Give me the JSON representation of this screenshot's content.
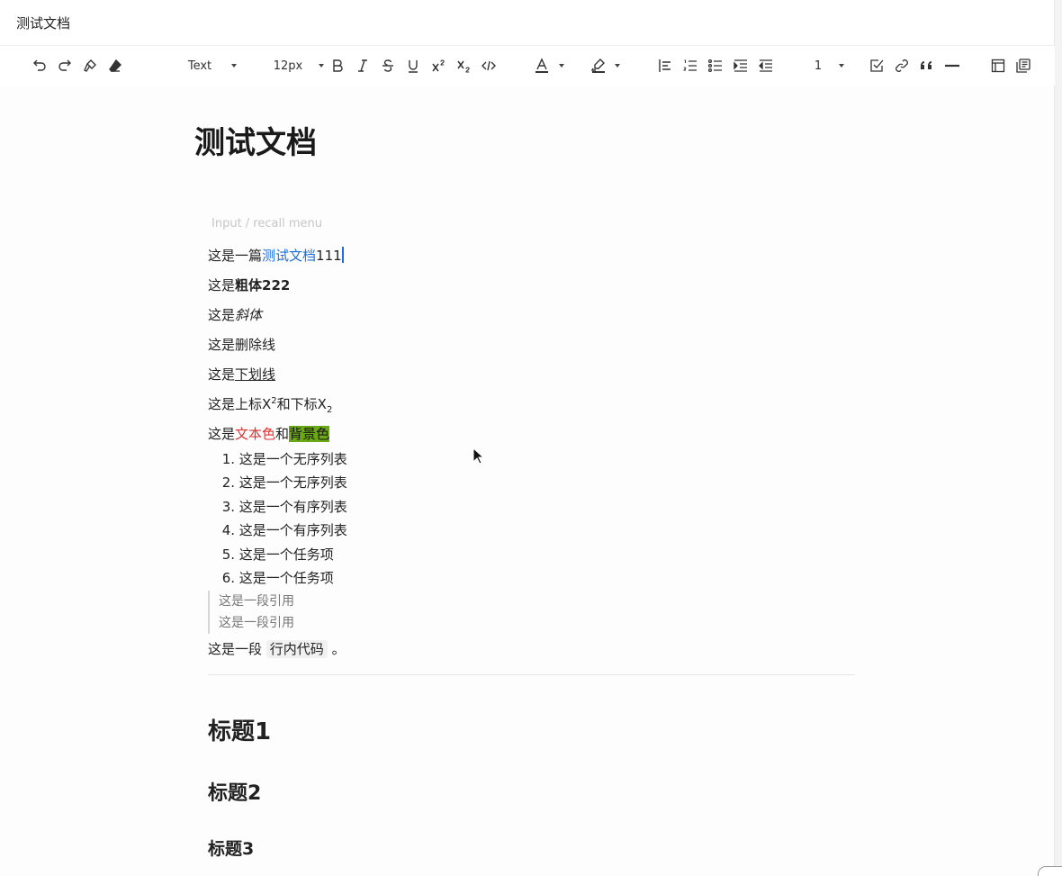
{
  "window": {
    "title": "测试文档"
  },
  "toolbar": {
    "undo_icon": "undo-icon",
    "redo_icon": "redo-icon",
    "format_painter_icon": "format-painter-icon",
    "clear_format_icon": "eraser-icon",
    "paragraph_style": "Text",
    "font_size": "12px",
    "line_height": "1",
    "accent_color": "#1e6fd9"
  },
  "doc": {
    "title": "测试文档",
    "placeholder": "Input / recall menu",
    "p1": {
      "prefix": "这是一篇",
      "link": "测试文档",
      "suffix": "111"
    },
    "p2": {
      "prefix": "这是",
      "bold": "粗体222"
    },
    "p3": {
      "prefix": "这是",
      "italic": "斜体"
    },
    "p4": {
      "prefix": "这是",
      "strike": "删除线"
    },
    "p5": {
      "prefix": "这是",
      "underline": "下划线"
    },
    "p6": {
      "prefix": "这是上标X",
      "sup": "2",
      "mid": "和下标X",
      "sub": "2"
    },
    "p7": {
      "prefix": "这是",
      "colored": "文本色",
      "mid": "和",
      "highlight": "背景色",
      "text_color": "#e03131",
      "bg_color": "#6aa814"
    },
    "list": [
      {
        "num": "1.",
        "text": "这是一个无序列表"
      },
      {
        "num": "2.",
        "text": "这是一个无序列表"
      },
      {
        "num": "3.",
        "text": "这是一个有序列表"
      },
      {
        "num": "4.",
        "text": "这是一个有序列表"
      },
      {
        "num": "5.",
        "text": "这是一个任务项"
      },
      {
        "num": "6.",
        "text": "这是一个任务项"
      }
    ],
    "quote": [
      "这是一段引用",
      "这是一段引用"
    ],
    "code_para": {
      "prefix": "这是一段",
      "code": "行内代码",
      "suffix": "。"
    },
    "h1": "标题1",
    "h2": "标题2",
    "h3": "标题3"
  }
}
